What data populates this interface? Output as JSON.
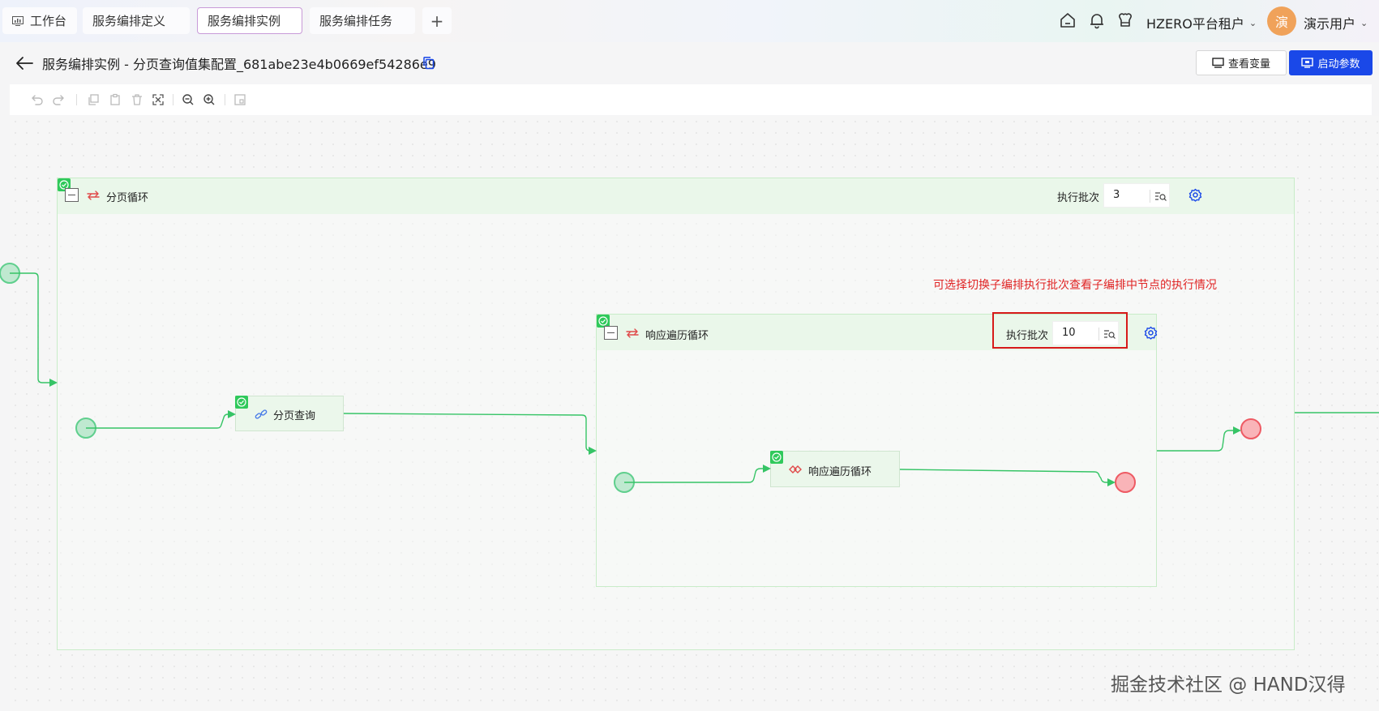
{
  "tabs": [
    {
      "label": "工作台",
      "active": false
    },
    {
      "label": "服务编排定义",
      "active": false
    },
    {
      "label": "服务编排实例",
      "active": true
    },
    {
      "label": "服务编排任务",
      "active": false
    }
  ],
  "header_icons": [
    "home-icon",
    "bell-icon",
    "apps-icon"
  ],
  "tenant": "HZERO平台租户",
  "user": {
    "avatar_char": "演",
    "name": "演示用户"
  },
  "page": {
    "title": "服务编排实例 - 分页查询值集配置_681abe23e4b0669ef54286e9"
  },
  "buttons": {
    "view_variables": "查看变量",
    "start_params": "启动参数"
  },
  "toolbar_icons": [
    "undo-icon",
    "redo-icon",
    "copy-icon",
    "paste-icon",
    "delete-icon",
    "fit-view-icon",
    "zoom-out-icon",
    "zoom-in-icon",
    "minimap-icon"
  ],
  "flow": {
    "outer_loop": {
      "name": "分页循环",
      "batch_label": "执行批次",
      "batch_value": "3"
    },
    "page_query": {
      "name": "分页查询"
    },
    "inner_loop": {
      "name": "响应遍历循环",
      "batch_label": "执行批次",
      "batch_value": "10"
    },
    "inner_task": {
      "name": "响应遍历循环"
    }
  },
  "annotation": "可选择切换子编排执行批次查看子编排中节点的执行情况",
  "watermark": "掘金技术社区 @ HAND汉得",
  "colors": {
    "primary": "#1a48e8",
    "edge": "#36c466",
    "start": "#5fcf8d",
    "end": "#ee5a63",
    "annotation": "#e02424"
  }
}
